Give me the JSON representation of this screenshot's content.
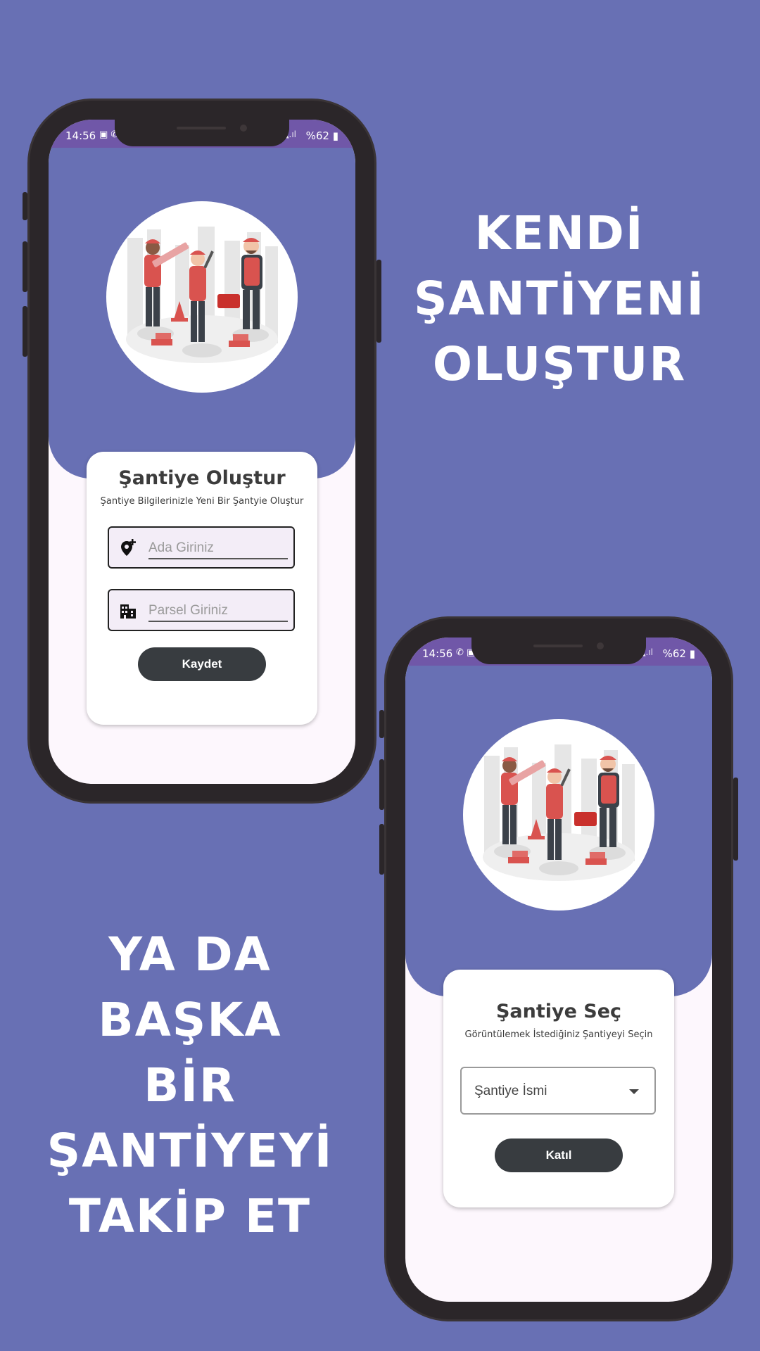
{
  "colors": {
    "background": "#6870B4",
    "status_bar": "#7057A8",
    "phone_frame": "#2B2629",
    "button": "#383C40",
    "screen_bg": "#FDF7FD",
    "input_fill": "#F3EDF7"
  },
  "promo_top": {
    "lines": [
      "KENDİ",
      "ŞANTİYENİ",
      "OLUŞTUR"
    ]
  },
  "promo_bottom": {
    "lines": [
      "YA DA BAŞKA",
      "BİR",
      "ŞANTİYEYİ",
      "TAKİP ET"
    ]
  },
  "phone_create": {
    "status": {
      "time": "14:56",
      "battery": "%62"
    },
    "illustration": "construction-workers-illustration",
    "card": {
      "title": "Şantiye Oluştur",
      "subtitle": "Şantiye Bilgilerinizle Yeni Bir Şantyie Oluştur",
      "fields": [
        {
          "icon": "add-location-icon",
          "placeholder": "Ada Giriniz"
        },
        {
          "icon": "apartment-icon",
          "placeholder": "Parsel Giriniz"
        }
      ],
      "button": "Kaydet"
    }
  },
  "phone_select": {
    "status": {
      "time": "14:56",
      "battery": "%62"
    },
    "illustration": "construction-workers-illustration",
    "card": {
      "title": "Şantiye Seç",
      "subtitle": "Görüntülemek İstediğiniz Şantiyeyi Seçin",
      "dropdown": {
        "value": "Şantiye İsmi",
        "icon": "dropdown-arrow-icon"
      },
      "button": "Katıl"
    }
  }
}
